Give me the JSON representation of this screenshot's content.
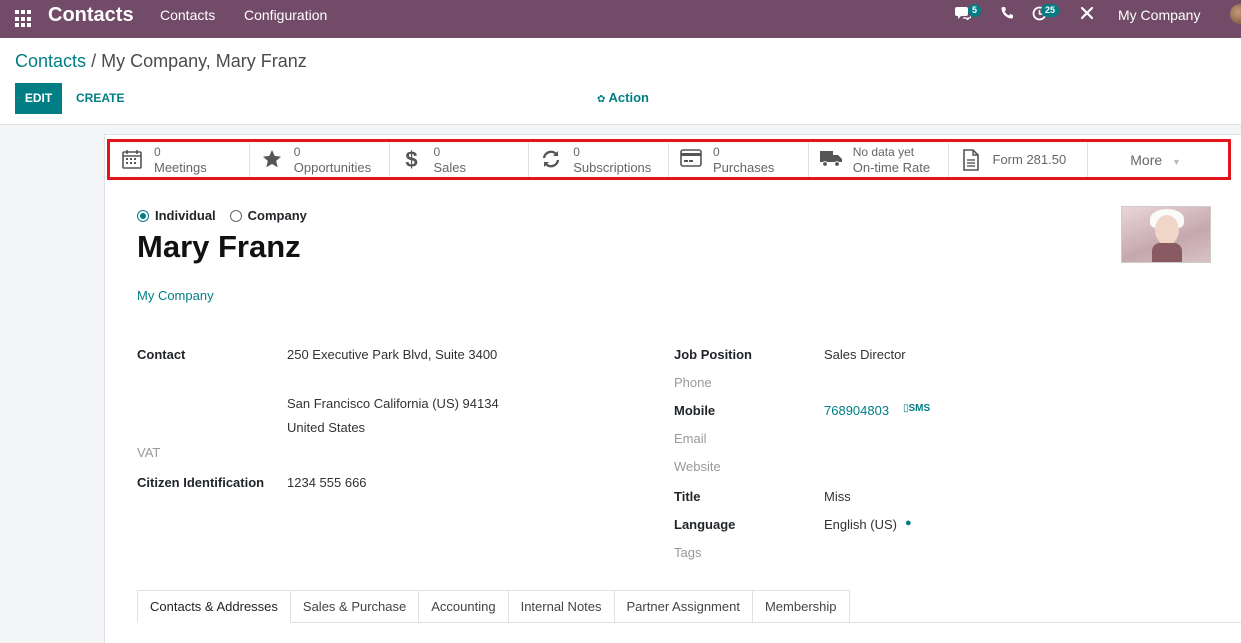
{
  "topbar": {
    "app_name": "Contacts",
    "menu": [
      "Contacts",
      "Configuration"
    ],
    "chat_badge": "5",
    "activity_badge": "25",
    "company": "My Company",
    "color": "#714b67"
  },
  "breadcrumb": {
    "parent": "Contacts",
    "separator": "/",
    "current": "My Company, Mary Franz"
  },
  "toolbar": {
    "edit": "EDIT",
    "create": "CREATE",
    "action": "Action"
  },
  "smart_buttons": [
    {
      "icon": "calendar-icon",
      "count": "0",
      "label": "Meetings"
    },
    {
      "icon": "star-icon",
      "count": "0",
      "label": "Opportunities"
    },
    {
      "icon": "dollar-icon",
      "count": "0",
      "label": "Sales"
    },
    {
      "icon": "refresh-icon",
      "count": "0",
      "label": "Subscriptions"
    },
    {
      "icon": "credit-card-icon",
      "count": "0",
      "label": "Purchases"
    },
    {
      "icon": "truck-icon",
      "count": "No data yet",
      "label": "On-time Rate"
    },
    {
      "icon": "document-icon",
      "label": "Form 281.50"
    },
    {
      "label": "More"
    }
  ],
  "partner_type": {
    "individual": "Individual",
    "company": "Company",
    "selected": "Individual"
  },
  "partner_name": "Mary Franz",
  "parent_company": "My Company",
  "address": {
    "label": "Contact",
    "street": "250 Executive Park Blvd, Suite 3400",
    "city_line": "San Francisco  California (US)  94134",
    "country": "United States"
  },
  "vat_label": "VAT",
  "citizen_id": {
    "label": "Citizen Identification",
    "value": "1234 555 666"
  },
  "right_fields": {
    "job_position": {
      "label": "Job Position",
      "value": "Sales Director"
    },
    "phone": {
      "label": "Phone",
      "value": ""
    },
    "mobile": {
      "label": "Mobile",
      "value": "768904803",
      "sms": "SMS"
    },
    "email": {
      "label": "Email",
      "value": ""
    },
    "website": {
      "label": "Website",
      "value": ""
    },
    "title": {
      "label": "Title",
      "value": "Miss"
    },
    "language": {
      "label": "Language",
      "value": "English (US)"
    },
    "tags": {
      "label": "Tags",
      "value": ""
    }
  },
  "tabs": [
    "Contacts & Addresses",
    "Sales & Purchase",
    "Accounting",
    "Internal Notes",
    "Partner Assignment",
    "Membership"
  ],
  "active_tab": "Contacts & Addresses"
}
